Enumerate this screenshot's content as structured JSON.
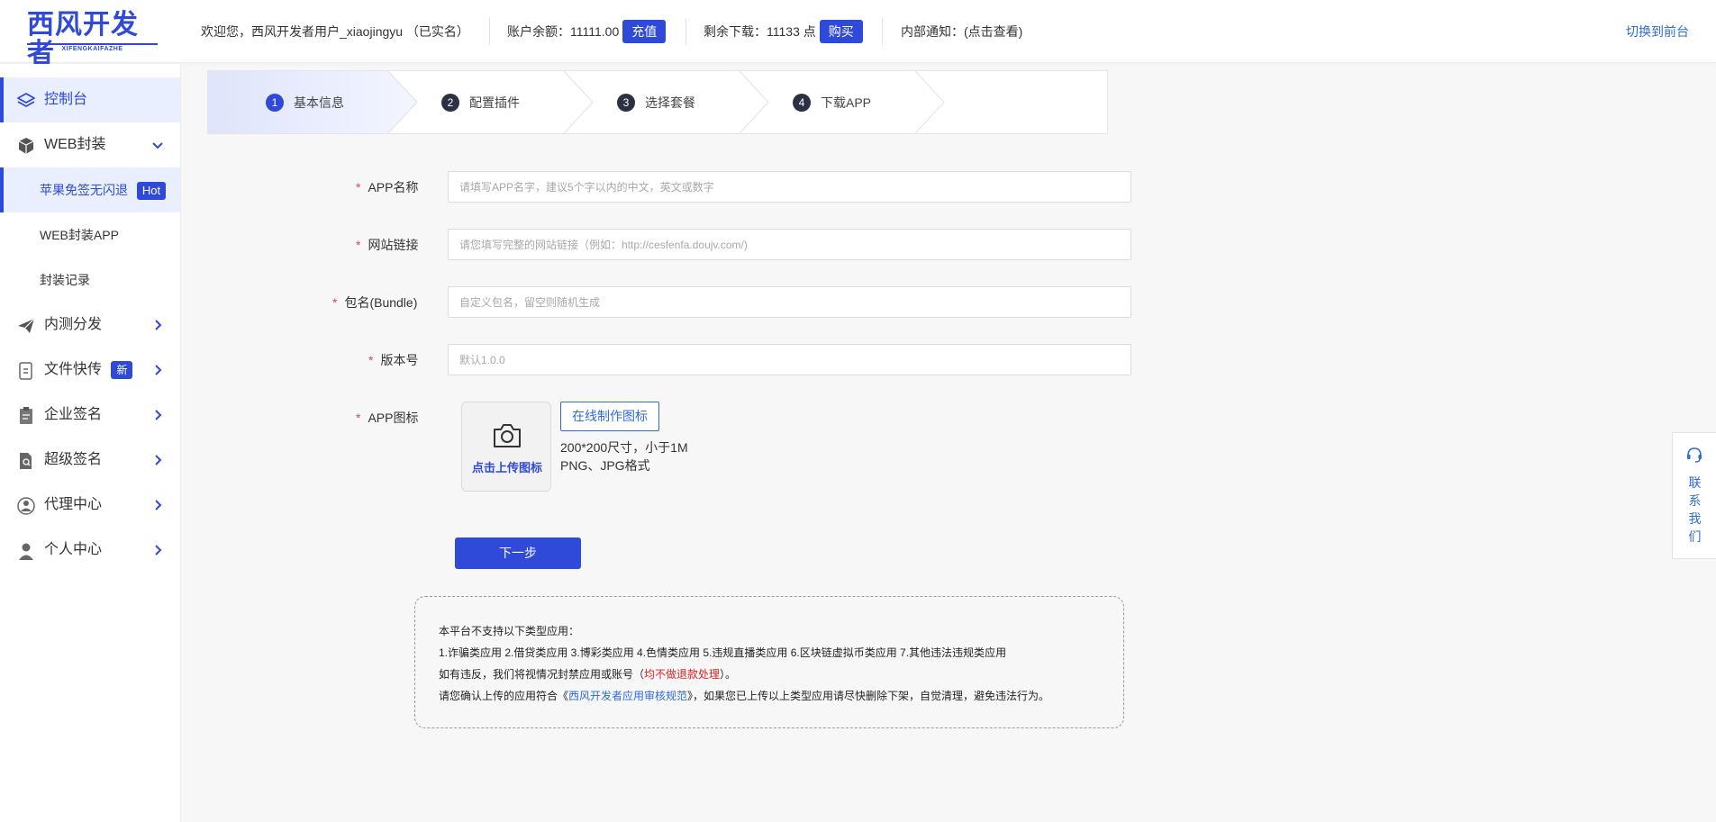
{
  "header": {
    "logo_main": "西风开发者",
    "logo_sub": "XIFENGKAIFAZHE",
    "welcome": "欢迎您，西风开发者用户_xiaojingyu （已实名）",
    "balance_label": "账户余额：11111.00",
    "recharge_button": "充值",
    "downloads_label": "剩余下载：11133 点",
    "buy_button": "购买",
    "notice_link": "内部通知：(点击查看)",
    "switch_front": "切换到前台"
  },
  "sidebar": {
    "console": "控制台",
    "web_wrap": "WEB封装",
    "sub_items": [
      {
        "label": "苹果免签无闪退",
        "badge": "Hot"
      },
      {
        "label": "WEB封装APP"
      },
      {
        "label": "封装记录"
      }
    ],
    "items": [
      {
        "label": "内测分发",
        "icon": "paper-plane-icon"
      },
      {
        "label": "文件快传",
        "icon": "file-transfer-icon",
        "badge": "新"
      },
      {
        "label": "企业签名",
        "icon": "clipboard-icon"
      },
      {
        "label": "超级签名",
        "icon": "document-search-icon"
      },
      {
        "label": "代理中心",
        "icon": "agent-icon"
      },
      {
        "label": "个人中心",
        "icon": "user-icon"
      }
    ]
  },
  "steps": [
    {
      "num": "1",
      "label": "基本信息"
    },
    {
      "num": "2",
      "label": "配置插件"
    },
    {
      "num": "3",
      "label": "选择套餐"
    },
    {
      "num": "4",
      "label": "下载APP"
    }
  ],
  "form": {
    "required_mark": "*",
    "app_name_label": "APP名称",
    "app_name_placeholder": "请填写APP名字，建议5个字以内的中文，英文或数字",
    "site_link_label": "网站链接",
    "site_link_placeholder": "请您填写完整的网站链接（例如：http://cesfenfa.doujv.com/)",
    "bundle_label": "包名(Bundle)",
    "bundle_placeholder": "自定义包名，留空则随机生成",
    "version_label": "版本号",
    "version_placeholder": "默认1.0.0",
    "icon_label": "APP图标",
    "upload_text": "点击上传图标",
    "online_make_button": "在线制作图标",
    "hint_size": "200*200尺寸，小于1M",
    "hint_format": "PNG、JPG格式",
    "next_button": "下一步"
  },
  "notice": {
    "line1": "本平台不支持以下类型应用：",
    "line2": "1.诈骗类应用 2.借贷类应用 3.博彩类应用 4.色情类应用 5.违规直播类应用 6.区块链虚拟币类应用 7.其他违法违规类应用",
    "line3_a": "如有违反，我们将视情况封禁应用或账号（",
    "line3_red": "均不做退款处理",
    "line3_b": "）。",
    "line4_a": "请您确认上传的应用符合《",
    "line4_link": "西风开发者应用审核规范",
    "line4_b": "》，如果您已上传以上类型应用请尽快删除下架，自觉清理，避免违法行为。"
  },
  "contact": {
    "chars": [
      "联",
      "系",
      "我",
      "们"
    ]
  },
  "colors": {
    "brand": "#2f4ad9",
    "link": "#2f6bd9",
    "warning": "#e02020"
  }
}
